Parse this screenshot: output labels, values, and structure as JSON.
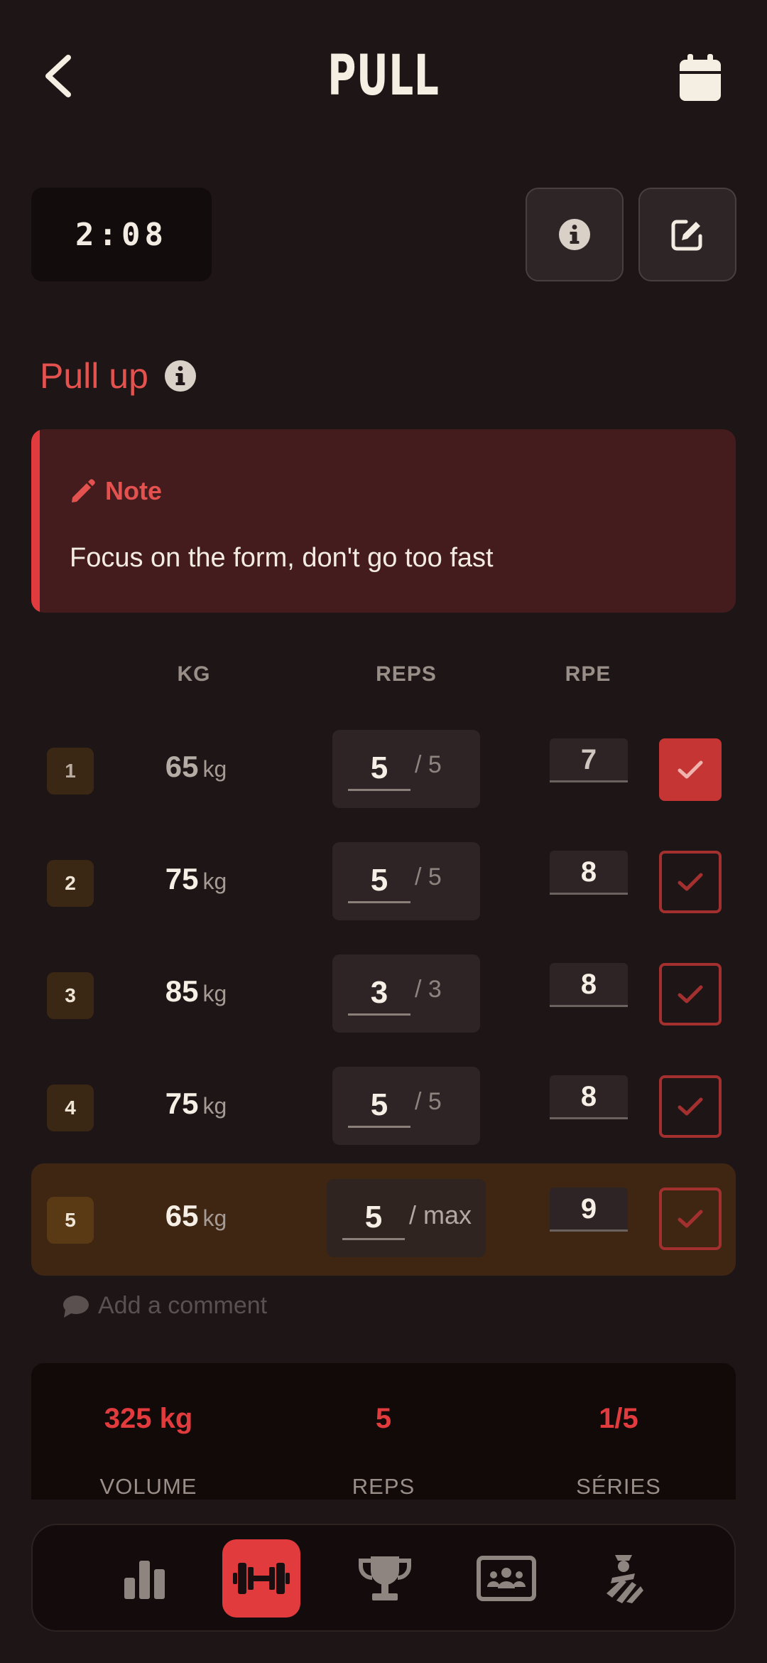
{
  "header": {
    "title": "PULL",
    "back_icon": "chevron-left-icon",
    "calendar_icon": "calendar-icon"
  },
  "timer": {
    "value": "2:08"
  },
  "actions": {
    "info_icon": "info-icon",
    "edit_icon": "edit-icon"
  },
  "exercise": {
    "name": "Pull up"
  },
  "note": {
    "heading": "Note",
    "text": "Focus on the form, don't go too fast"
  },
  "columns": {
    "kg": "KG",
    "reps": "REPS",
    "rpe": "RPE"
  },
  "sets": [
    {
      "num": "1",
      "kg": "65",
      "unit": "kg",
      "reps": "5",
      "target": "/ 5",
      "rpe": "7",
      "checked": true
    },
    {
      "num": "2",
      "kg": "75",
      "unit": "kg",
      "reps": "5",
      "target": "/ 5",
      "rpe": "8",
      "checked": false
    },
    {
      "num": "3",
      "kg": "85",
      "unit": "kg",
      "reps": "3",
      "target": "/ 3",
      "rpe": "8",
      "checked": false
    },
    {
      "num": "4",
      "kg": "75",
      "unit": "kg",
      "reps": "5",
      "target": "/ 5",
      "rpe": "8",
      "checked": false
    },
    {
      "num": "5",
      "kg": "65",
      "unit": "kg",
      "reps": "5",
      "target": "/ max",
      "rpe": "9",
      "checked": false,
      "active": true
    }
  ],
  "comment": {
    "placeholder": "Add a comment"
  },
  "summary": {
    "volume_value": "325 kg",
    "volume_label": "VOLUME",
    "reps_value": "5",
    "reps_label": "REPS",
    "series_value": "1/5",
    "series_label": "SÉRIES"
  },
  "nav": {
    "items": [
      "stats-icon",
      "dumbbell-icon",
      "trophy-icon",
      "group-icon",
      "athlete-icon"
    ],
    "active": "dumbbell-icon"
  },
  "colors": {
    "background": "#1e1516",
    "accent": "#e23b3e",
    "note_bg": "#441c1e",
    "active_row": "#3e2613"
  }
}
